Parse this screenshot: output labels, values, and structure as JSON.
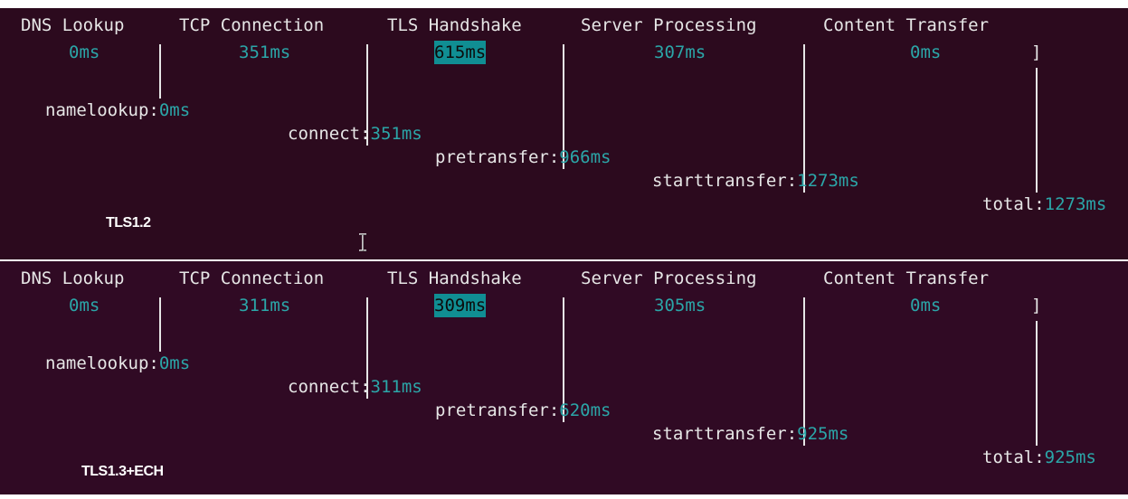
{
  "colors": {
    "terminal_bg_top": "#2c0a1e",
    "terminal_bg_bottom": "#300a24",
    "text": "#e6e6e6",
    "value": "#2ba6a8",
    "highlight_bg": "#108e93"
  },
  "headers": {
    "dns": "DNS Lookup",
    "tcp": "TCP Connection",
    "tls": "TLS Handshake",
    "server": "Server Processing",
    "transfer": "Content Transfer"
  },
  "labels": {
    "namelookup": "namelookup:",
    "connect": "connect:",
    "pretransfer": "pretransfer:",
    "starttransfer": "starttransfer:",
    "total": "total:",
    "bracket": "]"
  },
  "runs": [
    {
      "caption": "TLS1.2",
      "durations": {
        "dns": "0ms",
        "tcp": "351ms",
        "tls": "615ms",
        "server": "307ms",
        "transfer": "0ms"
      },
      "timeline": {
        "namelookup": "0ms",
        "connect": "351ms",
        "pretransfer": "966ms",
        "starttransfer": "1273ms",
        "total": "1273ms"
      }
    },
    {
      "caption": "TLS1.3+ECH",
      "durations": {
        "dns": "0ms",
        "tcp": "311ms",
        "tls": "309ms",
        "server": "305ms",
        "transfer": "0ms"
      },
      "timeline": {
        "namelookup": "0ms",
        "connect": "311ms",
        "pretransfer": "620ms",
        "starttransfer": "925ms",
        "total": "925ms"
      }
    }
  ]
}
